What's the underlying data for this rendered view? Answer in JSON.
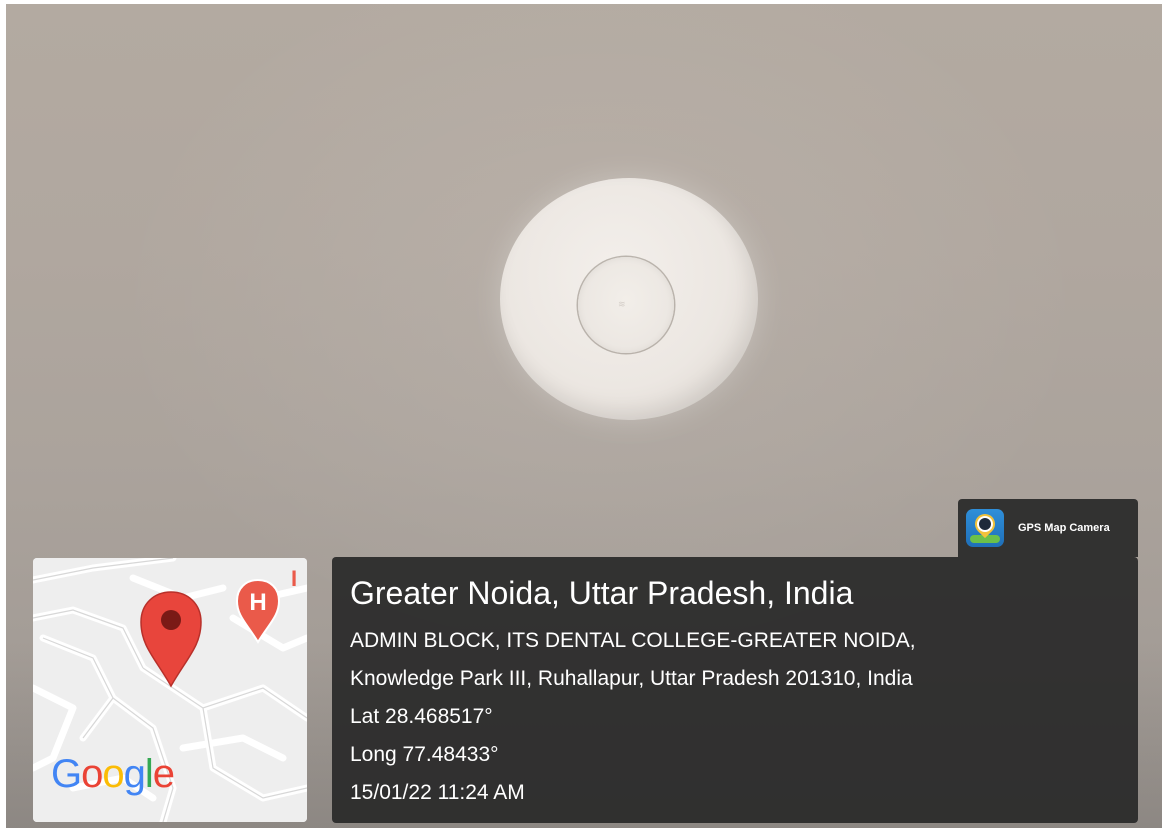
{
  "app_badge": {
    "name": "GPS Map Camera",
    "icon": "gps-map-camera-app-icon"
  },
  "location": {
    "title": "Greater Noida, Uttar Pradesh, India",
    "address_line1": "ADMIN BLOCK, ITS DENTAL COLLEGE-GREATER NOIDA,",
    "address_line2": "Knowledge Park III, Ruhallapur, Uttar Pradesh 201310, India",
    "latitude": "Lat 28.468517°",
    "longitude": "Long 77.48433°",
    "timestamp": "15/01/22 11:24 AM"
  },
  "map": {
    "logo": "Google",
    "pin_icon": "map-pin-icon",
    "poi_icon": "hospital-icon",
    "poi_label": "H",
    "edge_text": "I",
    "colors": {
      "pin": "#e8453c",
      "poi": "#ea5a4a",
      "road": "#ffffff",
      "land": "#f0f0f0"
    }
  }
}
